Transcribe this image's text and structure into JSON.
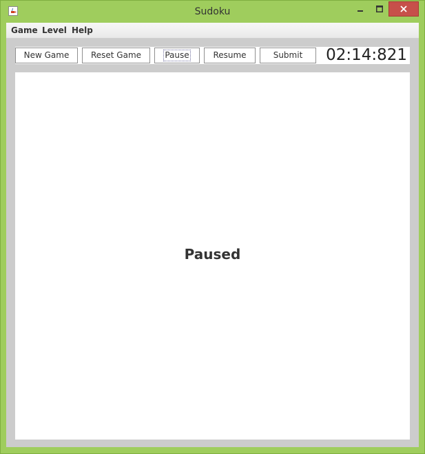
{
  "window": {
    "title": "Sudoku",
    "app_icon": "java-cup-icon"
  },
  "menubar": {
    "items": [
      {
        "label": "Game"
      },
      {
        "label": "Level"
      },
      {
        "label": "Help"
      }
    ]
  },
  "toolbar": {
    "new_game_label": "New Game",
    "reset_game_label": "Reset Game",
    "pause_label": "Pause",
    "resume_label": "Resume",
    "submit_label": "Submit",
    "timer": "02:14:821"
  },
  "board": {
    "status_text": "Paused"
  },
  "colors": {
    "window_frame": "#9fcd5d",
    "close_button": "#c7504a",
    "content_background": "#cccccc",
    "board_background": "#ffffff"
  }
}
